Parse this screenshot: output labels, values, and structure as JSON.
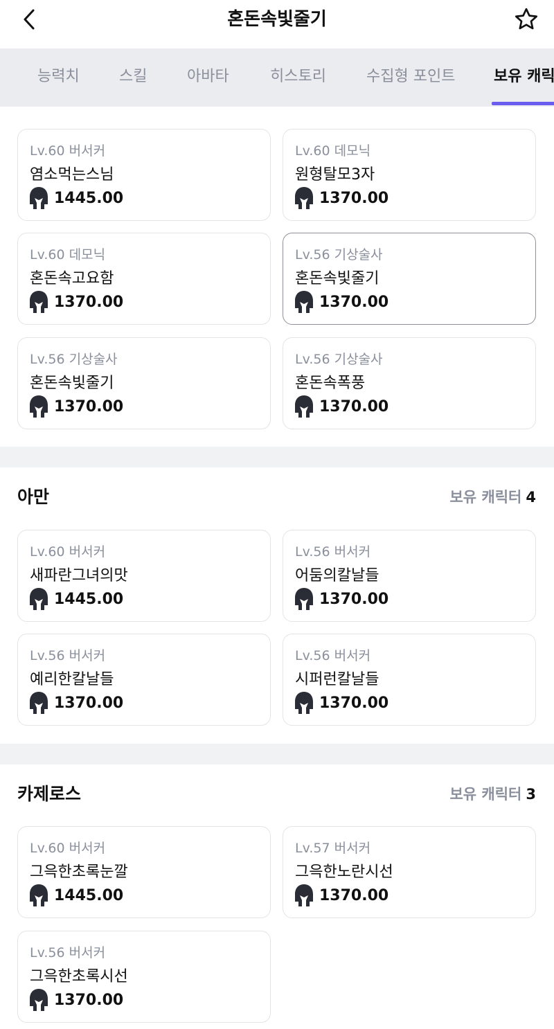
{
  "header": {
    "title": "혼돈속빛줄기"
  },
  "tabs": [
    {
      "label": "능력치"
    },
    {
      "label": "스킬"
    },
    {
      "label": "아바타"
    },
    {
      "label": "히스토리"
    },
    {
      "label": "수집형 포인트"
    },
    {
      "label": "보유 캐릭"
    }
  ],
  "colors": {
    "accent": "#6b5cf0",
    "muted": "#8a8f9c",
    "card_border": "#e3e4e8"
  },
  "sections": [
    {
      "characters": [
        {
          "level": "Lv.60 버서커",
          "name": "염소먹는스님",
          "power": "1445.00"
        },
        {
          "level": "Lv.60 데모닉",
          "name": "원형탈모3자",
          "power": "1370.00"
        },
        {
          "level": "Lv.60 데모닉",
          "name": "혼돈속고요함",
          "power": "1370.00"
        },
        {
          "level": "Lv.56 기상술사",
          "name": "혼돈속빛줄기",
          "power": "1370.00",
          "selected": true
        },
        {
          "level": "Lv.56 기상술사",
          "name": "혼돈속빛줄기",
          "power": "1370.00"
        },
        {
          "level": "Lv.56 기상술사",
          "name": "혼돈속폭풍",
          "power": "1370.00"
        }
      ]
    },
    {
      "server": "아만",
      "count_label": "보유 캐릭터",
      "count": "4",
      "characters": [
        {
          "level": "Lv.60 버서커",
          "name": "새파란그녀의맛",
          "power": "1445.00"
        },
        {
          "level": "Lv.56 버서커",
          "name": "어둠의칼날들",
          "power": "1370.00"
        },
        {
          "level": "Lv.56 버서커",
          "name": "예리한칼날들",
          "power": "1370.00"
        },
        {
          "level": "Lv.56 버서커",
          "name": "시퍼런칼날들",
          "power": "1370.00"
        }
      ]
    },
    {
      "server": "카제로스",
      "count_label": "보유 캐릭터",
      "count": "3",
      "characters": [
        {
          "level": "Lv.60 버서커",
          "name": "그윽한초록눈깔",
          "power": "1445.00"
        },
        {
          "level": "Lv.57 버서커",
          "name": "그윽한노란시선",
          "power": "1370.00"
        },
        {
          "level": "Lv.56 버서커",
          "name": "그윽한초록시선",
          "power": "1370.00"
        }
      ]
    }
  ]
}
